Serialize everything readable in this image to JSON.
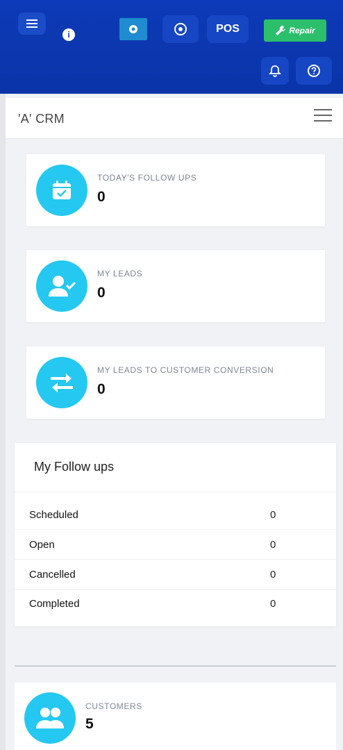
{
  "topbar": {
    "pos_label": "POS",
    "repair_label": "Repair",
    "info_glyph": "i",
    "colors": {
      "primary": "#0d3ab8",
      "repair": "#2bbf6b",
      "accent": "#25c8f0"
    }
  },
  "crm": {
    "title": "'A' CRM"
  },
  "stats": [
    {
      "label": "TODAY'S FOLLOW UPS",
      "value": "0",
      "icon": "calendar-check-icon"
    },
    {
      "label": "MY LEADS",
      "value": "0",
      "icon": "user-check-icon"
    },
    {
      "label": "MY LEADS TO CUSTOMER CONVERSION",
      "value": "0",
      "icon": "exchange-arrows-icon"
    }
  ],
  "follow_ups": {
    "title": "My Follow ups",
    "rows": [
      {
        "name": "Scheduled",
        "count": "0"
      },
      {
        "name": "Open",
        "count": "0"
      },
      {
        "name": "Cancelled",
        "count": "0"
      },
      {
        "name": "Completed",
        "count": "0"
      }
    ]
  },
  "customers": {
    "label": "CUSTOMERS",
    "value": "5",
    "icon": "users-icon"
  }
}
